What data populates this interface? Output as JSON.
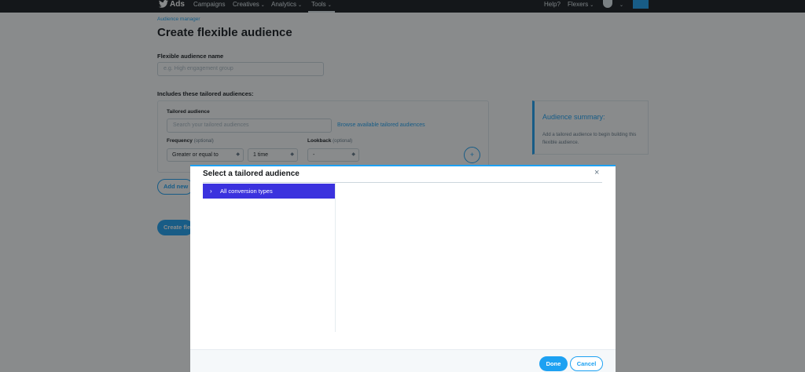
{
  "nav": {
    "brand": "Ads",
    "items": [
      {
        "label": "Campaigns",
        "chevron": false
      },
      {
        "label": "Creatives",
        "chevron": true
      },
      {
        "label": "Analytics",
        "chevron": true
      },
      {
        "label": "Tools",
        "chevron": true
      }
    ],
    "help": "Help?",
    "account": "Flexers",
    "chevron_glyph": "⌄"
  },
  "page": {
    "breadcrumb": "Audience manager",
    "title": "Create flexible audience",
    "name_label": "Flexible audience name",
    "name_placeholder": "e.g. High engagement group",
    "includes_label": "Includes these tailored audiences:",
    "tailored_label": "Tailored audience",
    "tailored_placeholder": "Search your tailored audiences",
    "browse_link": "Browse available tailored audiences",
    "frequency_label": "Frequency",
    "frequency_optional": "(optional)",
    "frequency_operator": "Greater or equal to",
    "frequency_value": "1 time",
    "lookback_label": "Lookback",
    "lookback_optional": "(optional)",
    "lookback_value": "-",
    "add_glyph": "+",
    "add_new_button": "Add new",
    "create_button": "Create flexible audience",
    "summary_title": "Audience summary:",
    "summary_text": "Add a tailored audience to begin building this flexible audience."
  },
  "modal": {
    "title": "Select a tailored audience",
    "close_glyph": "×",
    "tree_items": [
      {
        "label": "All conversion types",
        "selected": true,
        "caret": "›"
      }
    ],
    "done_button": "Done",
    "cancel_button": "Cancel"
  },
  "colors": {
    "accent": "#1da1f2",
    "selected_row": "#3b32de",
    "nav_background": "#14171a"
  },
  "icons": [
    "twitter-bird-icon",
    "chevron-down-icon",
    "avatar-icon",
    "plus-icon",
    "close-icon",
    "chevron-right-icon"
  ]
}
